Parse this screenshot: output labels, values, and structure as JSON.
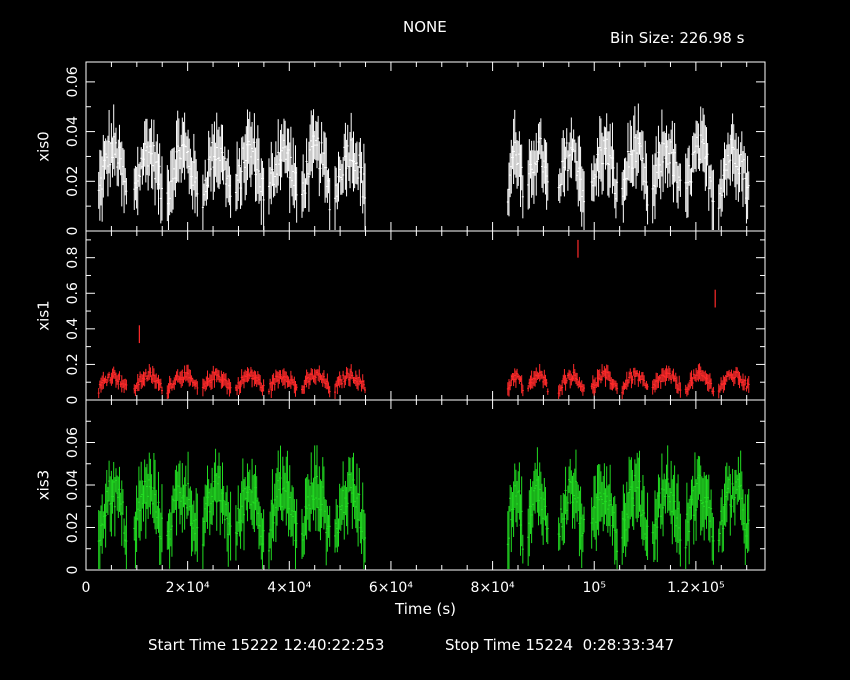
{
  "header": {
    "title": "NONE",
    "bin_size": "Bin Size: 226.98 s"
  },
  "footer": {
    "start_time": "Start Time 15222 12:40:22:253",
    "stop_time": "Stop Time 15224  0:28:33:347"
  },
  "chart_data": [
    {
      "type": "scatter",
      "panel": "top",
      "ylabel": "xis0",
      "color": "#ffffff",
      "xlim": [
        0,
        133600
      ],
      "ylim": [
        0,
        0.068
      ],
      "yticks": [
        0,
        0.02,
        0.04,
        0.06
      ],
      "ytick_labels": [
        "0",
        "0.02",
        "0.04",
        "0.06"
      ],
      "segments": [
        [
          2500,
          8000
        ],
        [
          9500,
          15000
        ],
        [
          16000,
          22000
        ],
        [
          23000,
          28500
        ],
        [
          29500,
          35000
        ],
        [
          36000,
          41500
        ],
        [
          42500,
          48000
        ],
        [
          49000,
          55000
        ],
        [
          83000,
          86000
        ],
        [
          87000,
          91000
        ],
        [
          93000,
          98000
        ],
        [
          99500,
          104500
        ],
        [
          105500,
          110500
        ],
        [
          111500,
          117000
        ],
        [
          118000,
          123500
        ],
        [
          124500,
          130500
        ]
      ],
      "level": 0.026,
      "spread": 0.011
    },
    {
      "type": "scatter",
      "panel": "middle",
      "ylabel": "xis1",
      "color": "#ff2a2a",
      "xlim": [
        0,
        133600
      ],
      "ylim": [
        0,
        0.95
      ],
      "yticks": [
        0,
        0.2,
        0.4,
        0.6,
        0.8
      ],
      "ytick_labels": [
        "0",
        "0.2",
        "0.4",
        "0.6",
        "0.8"
      ],
      "segments": [
        [
          2500,
          8000
        ],
        [
          9500,
          15000
        ],
        [
          16000,
          22000
        ],
        [
          23000,
          28500
        ],
        [
          29500,
          35000
        ],
        [
          36000,
          41500
        ],
        [
          42500,
          48000
        ],
        [
          49000,
          55000
        ],
        [
          83000,
          86000
        ],
        [
          87000,
          91000
        ],
        [
          93000,
          98000
        ],
        [
          99500,
          104500
        ],
        [
          105500,
          110500
        ],
        [
          111500,
          117000
        ],
        [
          118000,
          123500
        ],
        [
          124500,
          130500
        ]
      ],
      "level": 0.11,
      "spread": 0.04,
      "outliers": [
        {
          "x": 96800,
          "y": 0.85
        },
        {
          "x": 123800,
          "y": 0.57
        },
        {
          "x": 10500,
          "y": 0.37
        }
      ]
    },
    {
      "type": "scatter",
      "panel": "bottom",
      "ylabel": "xis3",
      "xlabel": "Time (s)",
      "color": "#22dd22",
      "xlim": [
        0,
        133600
      ],
      "ylim": [
        0,
        0.08
      ],
      "yticks": [
        0,
        0.02,
        0.04,
        0.06
      ],
      "ytick_labels": [
        "0",
        "0.02",
        "0.04",
        "0.06"
      ],
      "xticks": [
        0,
        20000,
        40000,
        60000,
        80000,
        100000,
        120000
      ],
      "xtick_labels": [
        "0",
        "2×10⁴",
        "4×10⁴",
        "6×10⁴",
        "8×10⁴",
        "10⁵",
        "1.2×10⁵"
      ],
      "segments": [
        [
          2500,
          8000
        ],
        [
          9500,
          15000
        ],
        [
          16000,
          22000
        ],
        [
          23000,
          28500
        ],
        [
          29500,
          35000
        ],
        [
          36000,
          41500
        ],
        [
          42500,
          48000
        ],
        [
          49000,
          55000
        ],
        [
          83000,
          86000
        ],
        [
          87000,
          91000
        ],
        [
          93000,
          98000
        ],
        [
          99500,
          104500
        ],
        [
          105500,
          110500
        ],
        [
          111500,
          117000
        ],
        [
          118000,
          123500
        ],
        [
          124500,
          130500
        ]
      ],
      "level": 0.03,
      "spread": 0.013
    }
  ]
}
